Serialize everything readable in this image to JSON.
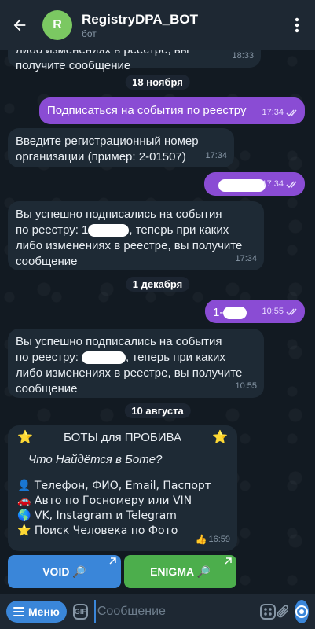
{
  "header": {
    "avatar_letter": "R",
    "title": "RegistryDPA_BOT",
    "subtitle": "бот"
  },
  "messages": {
    "m1_text": "либо изменениях в реестре, вы получите сообщение",
    "m1_time": "18:33",
    "date1": "18 ноября",
    "m2_text": "Подписаться на события по реестру",
    "m2_time": "17:34",
    "m3_text": "Введите регистрационный номер организации (пример: 2-01507)",
    "m3_time": "17:34",
    "m4_time": "17:34",
    "m5_line1": "Вы успешно подписались на события",
    "m5_prefix": "по реестру: 1",
    "m5_suffix": ", теперь при каких",
    "m5_line3": "либо изменениях в реестре, вы получите",
    "m5_line4": "сообщение",
    "m5_time": "17:34",
    "date2": "1 декабря",
    "m6_prefix": "1-",
    "m6_time": "10:55",
    "m7_line1": "Вы успешно подписались на события",
    "m7_prefix": "по реестру:",
    "m7_suffix": ", теперь при каких",
    "m7_line3": "либо изменениях в реестре, вы получите",
    "m7_line4": "сообщение",
    "m7_time": "10:55",
    "date3": "10 августа"
  },
  "promo": {
    "title": "БОТЫ для ПРОБИВА",
    "subtitle": "Что Найдётся в Боте?",
    "lines": [
      {
        "icon": "👤",
        "text": "Телефон, ФИО, Email, Паспорт"
      },
      {
        "icon": "🚗",
        "text": "Авто по Госномеру или VIN"
      },
      {
        "icon": "🌎",
        "text": "VK, Instagram и Telegram"
      },
      {
        "icon": "⭐",
        "text": "Поиск Человека по Фото"
      }
    ],
    "reaction": "👍",
    "time": "16:59"
  },
  "buttons": {
    "void_label": "VOID 🔎",
    "enigma_label": "ENIGMA 🔎"
  },
  "input": {
    "menu_label": "Меню",
    "gif_label": "GIF",
    "placeholder": "Сообщение"
  },
  "colors": {
    "header_bg": "#1e2833",
    "outgoing_bubble": "#8a4cd4",
    "incoming_bubble": "#1e2a35",
    "void_button": "#3a86d9",
    "enigma_button": "#4cae4c",
    "accent": "#3a86d9"
  }
}
